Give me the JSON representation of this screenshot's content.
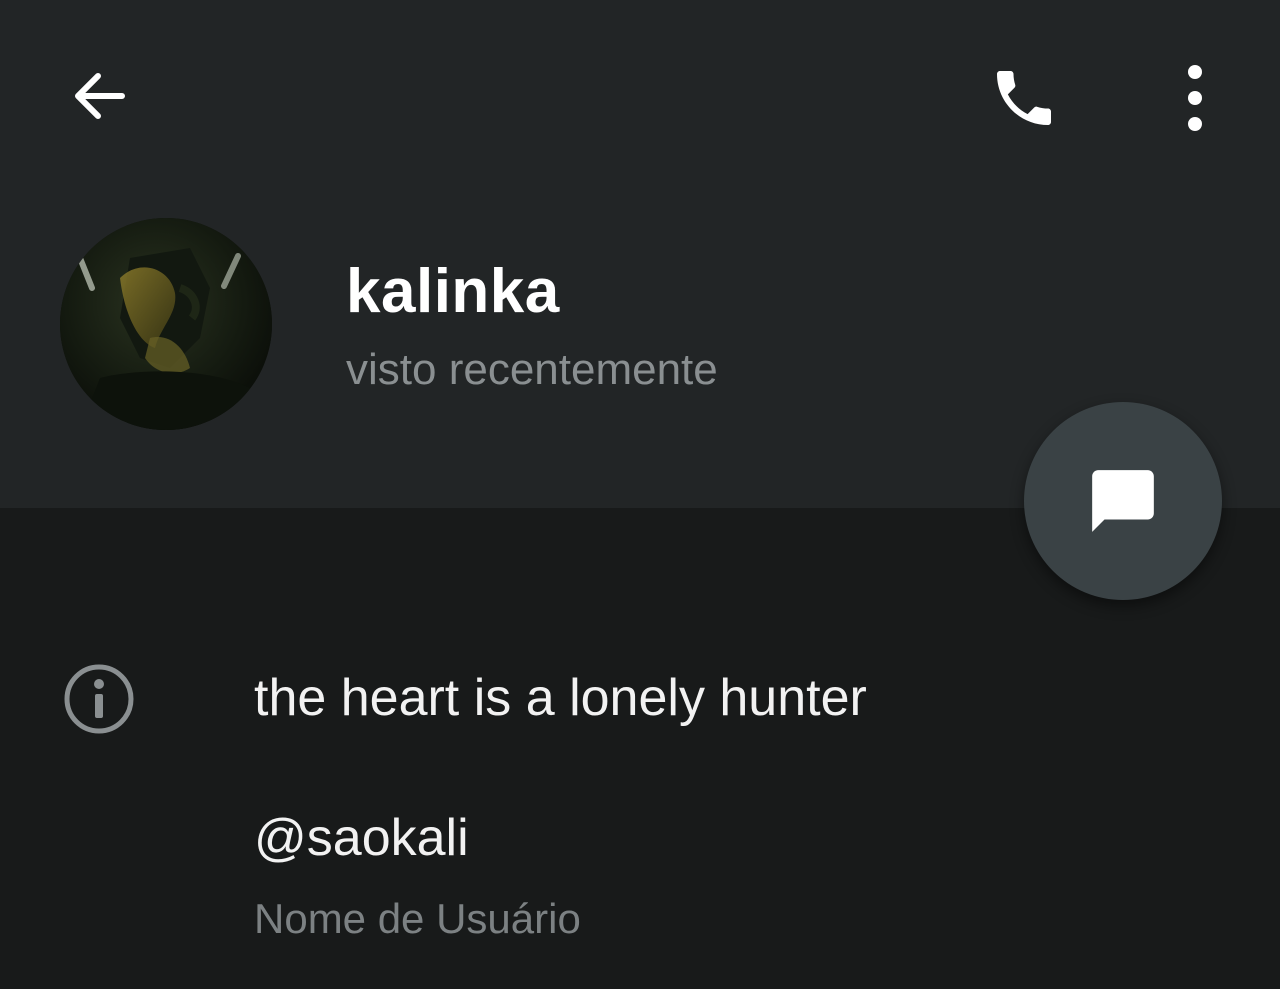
{
  "header": {
    "back_icon": "arrow-left-icon",
    "call_icon": "phone-icon",
    "more_icon": "more-vertical-icon"
  },
  "profile": {
    "name": "kalinka",
    "status": "visto recentemente",
    "avatar_icon": "profile-photo"
  },
  "fab": {
    "icon": "message-bubble-icon"
  },
  "info": {
    "icon": "info-circle-icon",
    "bio": "the heart is a lonely hunter",
    "username": "@saokali",
    "username_label": "Nome de Usuário"
  },
  "colors": {
    "header_bg": "#222526",
    "body_bg": "#181a1a",
    "fab_bg": "#3a4245",
    "primary_text": "#ffffff",
    "secondary_text": "#8a8f91"
  }
}
